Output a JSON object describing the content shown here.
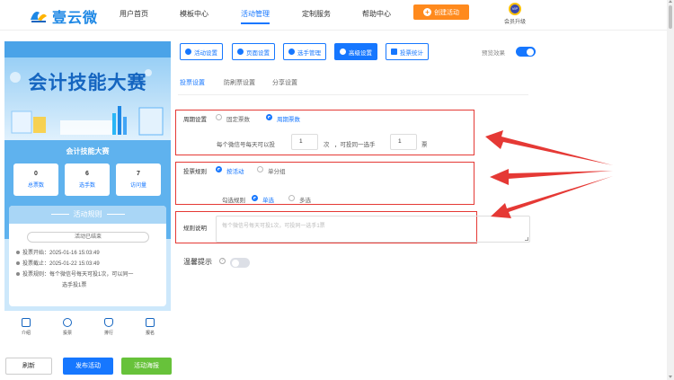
{
  "header": {
    "logo_text": "壹云微",
    "nav": [
      "用户首页",
      "模板中心",
      "活动管理",
      "定制服务",
      "帮助中心"
    ],
    "create_button": "创建活动",
    "vip_label": "会员升级",
    "vip_badge": "VIP"
  },
  "preview": {
    "banner_title": "会计技能大赛",
    "contest_name": "会计技能大赛",
    "stats": [
      {
        "value": "0",
        "label": "总票数"
      },
      {
        "value": "6",
        "label": "选手数"
      },
      {
        "value": "7",
        "label": "访问量"
      }
    ],
    "rules_title": "活动规则",
    "status_pill": "活动已结束",
    "rule_lines": [
      "投票开始：2025-01-16 15:03:49",
      "投票截止：2025-01-22 15:03:49",
      "投票规则：每个微信号每天可投1次，可以同一",
      "选手投1票"
    ],
    "bottom_nav": [
      "介绍",
      "投票",
      "排行",
      "报名"
    ]
  },
  "footer_buttons": {
    "reset": "刷新",
    "publish": "发布活动",
    "poster": "活动海报"
  },
  "toolbar": {
    "buttons": [
      "活动设置",
      "页面设置",
      "选手管理",
      "高级设置",
      "投票统计"
    ],
    "active_index": 3,
    "preview_effect_label": "预览效果",
    "preview_effect_on": true
  },
  "subtabs": [
    "投票设置",
    "防刷票设置",
    "分享设置"
  ],
  "settings": {
    "cycle_label": "周期设置",
    "cycle_options": [
      "固定票数",
      "周期票数"
    ],
    "cycle_selected": "周期票数",
    "per_day_prefix": "每个微信号每天可以投",
    "per_day_value": "1",
    "per_day_unit": "次",
    "same_player_prefix": "，可投同一选手",
    "same_player_value": "1",
    "same_player_unit": "票",
    "vote_rule_label": "投票规则",
    "vote_rule_options": [
      "按活动",
      "单分组"
    ],
    "vote_rule_selected": "按活动",
    "check_rule_label": "勾选规则",
    "check_rule_options": [
      "单选",
      "多选"
    ],
    "check_rule_selected": "单选",
    "rule_desc_label": "规则说明",
    "rule_desc_placeholder": "每个微信号每天可投1次，可投同一选手1票",
    "tips_label": "温馨提示",
    "tips_on": false
  },
  "colors": {
    "primary": "#1677ff",
    "orange": "#ff8a1d",
    "green": "#67c23a",
    "red_annotation": "#e53935"
  }
}
